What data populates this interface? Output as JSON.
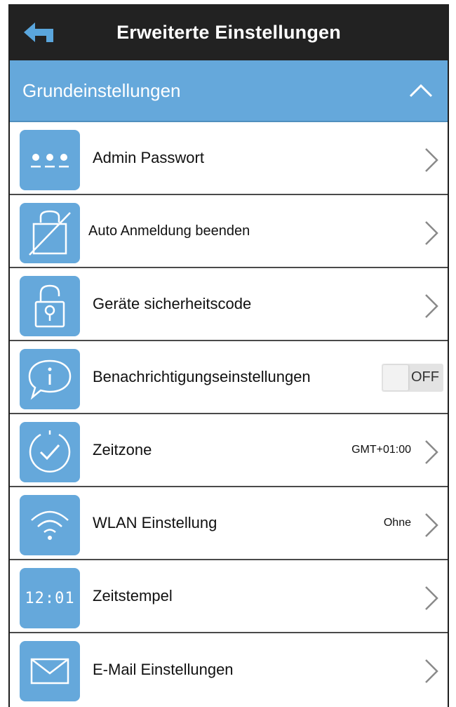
{
  "header": {
    "title": "Erweiterte Einstellungen",
    "back_icon": "back-arrow-icon"
  },
  "section": {
    "label": "Grundeinstellungen",
    "state_icon": "chevron-up-icon"
  },
  "colors": {
    "header_bg": "#222222",
    "accent": "#65a8db",
    "row_divider": "#4a4a4a"
  },
  "rows": [
    {
      "label": "Admin Passwort",
      "icon": "password-dots-icon"
    },
    {
      "label": "Auto Anmeldung beenden",
      "icon": "lock-disabled-icon"
    },
    {
      "label": "Geräte sicherheitscode",
      "icon": "padlock-icon"
    },
    {
      "label": "Benachrichtigungseinstellungen",
      "icon": "info-bubble-icon",
      "toggle": "OFF"
    },
    {
      "label": "Zeitzone",
      "icon": "clock-check-icon",
      "value": "GMT+01:00"
    },
    {
      "label": "WLAN Einstellung",
      "icon": "wifi-icon",
      "value": "Ohne"
    },
    {
      "label": "Zeitstempel",
      "icon": "digital-clock-icon",
      "clock_text": "12:01"
    },
    {
      "label": "E-Mail Einstellungen",
      "icon": "envelope-icon"
    }
  ]
}
